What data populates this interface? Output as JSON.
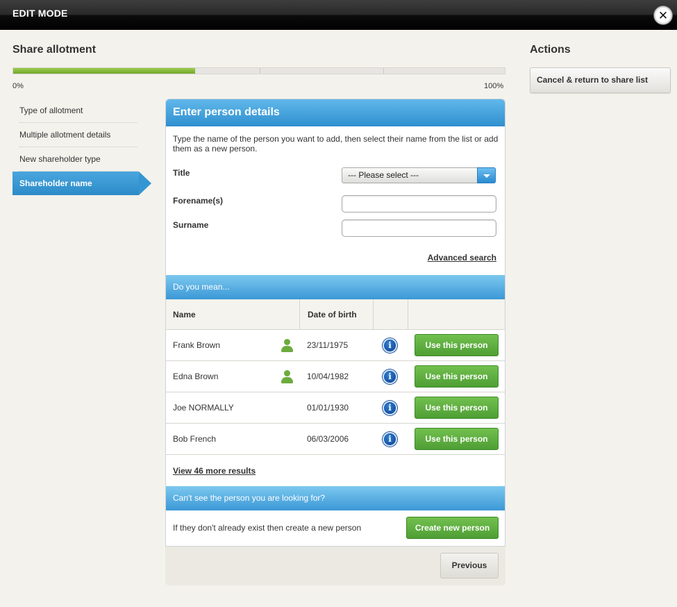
{
  "window": {
    "mode_title": "EDIT MODE",
    "close_icon": "close-icon"
  },
  "wizard": {
    "title": "Share allotment",
    "progress": {
      "percent": 37,
      "start_label": "0%",
      "end_label": "100%"
    },
    "steps": [
      {
        "label": "Type of allotment",
        "active": false
      },
      {
        "label": "Multiple allotment details",
        "active": false
      },
      {
        "label": "New shareholder type",
        "active": false
      },
      {
        "label": "Shareholder name",
        "active": true
      }
    ]
  },
  "actions": {
    "title": "Actions",
    "cancel_label": "Cancel & return to share list"
  },
  "person_form": {
    "heading": "Enter person details",
    "intro": "Type the name of the person you want to add, then select their name from the list or add them as a new person.",
    "title_label": "Title",
    "title_select_value": "--- Please select ---",
    "forename_label": "Forename(s)",
    "forename_value": "",
    "surname_label": "Surname",
    "surname_value": "",
    "advanced_search_label": "Advanced search"
  },
  "results": {
    "heading": "Do you mean...",
    "columns": {
      "name": "Name",
      "dob": "Date of birth"
    },
    "rows": [
      {
        "name": "Frank Brown",
        "has_person_icon": true,
        "dob": "23/11/1975",
        "info_icon": "i",
        "action": "Use this person"
      },
      {
        "name": "Edna Brown",
        "has_person_icon": true,
        "dob": "10/04/1982",
        "info_icon": "i",
        "action": "Use this person"
      },
      {
        "name": "Joe NORMALLY",
        "has_person_icon": false,
        "dob": "01/01/1930",
        "info_icon": "i",
        "action": "Use this person"
      },
      {
        "name": "Bob French",
        "has_person_icon": false,
        "dob": "06/03/2006",
        "info_icon": "i",
        "action": "Use this person"
      }
    ],
    "more_label": "View 46 more results"
  },
  "create": {
    "heading": "Can't see the person you are looking for?",
    "text": "If they don't already exist then create a new person",
    "button_label": "Create new person"
  },
  "navigation": {
    "previous_label": "Previous"
  },
  "colors": {
    "accent_blue": "#2f8fcf",
    "progress_green": "#7ab535",
    "button_green": "#5aab3d"
  }
}
